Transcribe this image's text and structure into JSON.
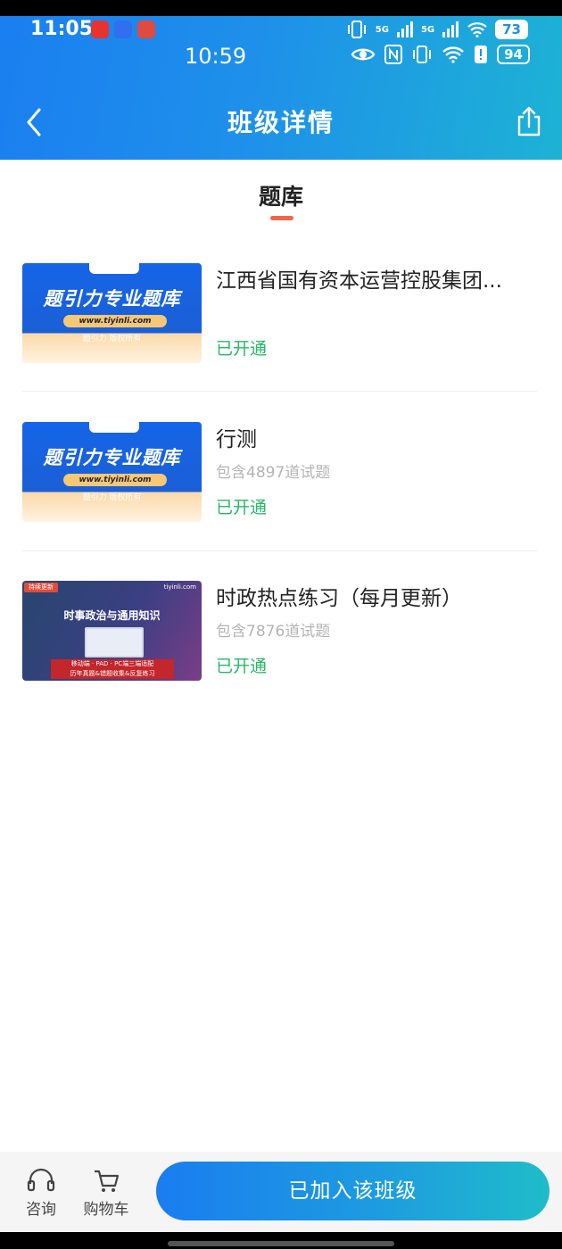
{
  "status_bar": {
    "outer_time": "11:05",
    "inner_time": "10:59",
    "signal_label_1": "5G",
    "signal_label_2": "5G",
    "battery_outer": "73",
    "battery_inner": "94",
    "icons": [
      "vibrate-icon",
      "signal-icon",
      "wifi-icon",
      "eye-icon",
      "nfc-icon",
      "alert-icon"
    ]
  },
  "nav": {
    "title": "班级详情",
    "back_icon": "chevron-left-icon",
    "share_icon": "share-icon"
  },
  "tab": {
    "label": "题库",
    "accent": "#f06544"
  },
  "items": [
    {
      "title": "江西省国有资本运营控股集团...",
      "count": "",
      "status": "已开通",
      "thumb": {
        "title": "题引力专业题库",
        "url": "www.tiyinli.com",
        "copyright": "题引力 版权所有"
      }
    },
    {
      "title": "行测",
      "count": "包含4897道试题",
      "status": "已开通",
      "thumb": {
        "title": "题引力专业题库",
        "url": "www.tiyinli.com",
        "copyright": "题引力 版权所有"
      }
    },
    {
      "title": "时政热点练习（每月更新）",
      "count": "包含7876道试题",
      "status": "已开通",
      "thumb": {
        "badge": "持续更新",
        "site": "tiyinli.com",
        "subtitle": "时事政治与通用知识",
        "line1": "移动端 · PAD · PC端三端适配",
        "line2": "历年真题&错题收集&反复练习"
      }
    }
  ],
  "bottom": {
    "consult_label": "咨询",
    "cart_label": "购物车",
    "join_label": "已加入该班级"
  },
  "colors": {
    "header_start": "#1a7ff0",
    "header_end": "#1db3d4",
    "status_green": "#25b866"
  }
}
